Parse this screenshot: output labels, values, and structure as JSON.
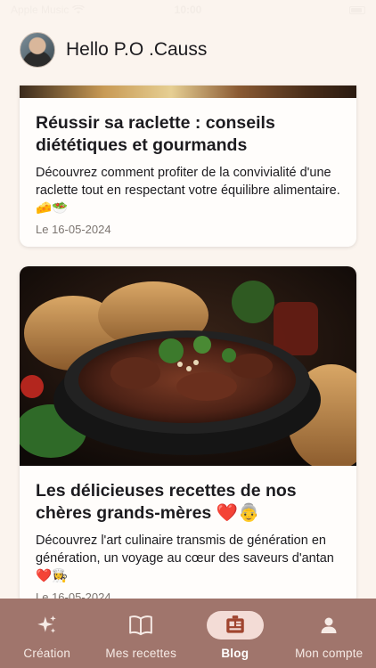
{
  "status": {
    "carrier": "Apple Music",
    "time": "10:00"
  },
  "header": {
    "greeting": "Hello P.O .Causs"
  },
  "posts": [
    {
      "title": "Réussir sa raclette : conseils diététiques et gourmands",
      "description": "Découvrez comment profiter de la convivialité d'une raclette tout en respectant votre équilibre alimentaire. 🧀🥗",
      "date": "Le 16-05-2024"
    },
    {
      "title": "Les délicieuses recettes de nos chères grands-mères ❤️👵",
      "description": "Découvrez l'art culinaire transmis de génération en génération, un voyage au cœur des saveurs d'antan ❤️👩‍🍳",
      "date": "Le 16-05-2024"
    }
  ],
  "nav": {
    "items": [
      {
        "label": "Création",
        "icon": "sparkles-icon"
      },
      {
        "label": "Mes recettes",
        "icon": "book-icon"
      },
      {
        "label": "Blog",
        "icon": "newspaper-icon",
        "active": true
      },
      {
        "label": "Mon compte",
        "icon": "person-icon"
      }
    ]
  },
  "colors": {
    "background": "#fbf4ee",
    "nav_bar": "#a0756c",
    "active_pill": "#f3dcd6"
  }
}
